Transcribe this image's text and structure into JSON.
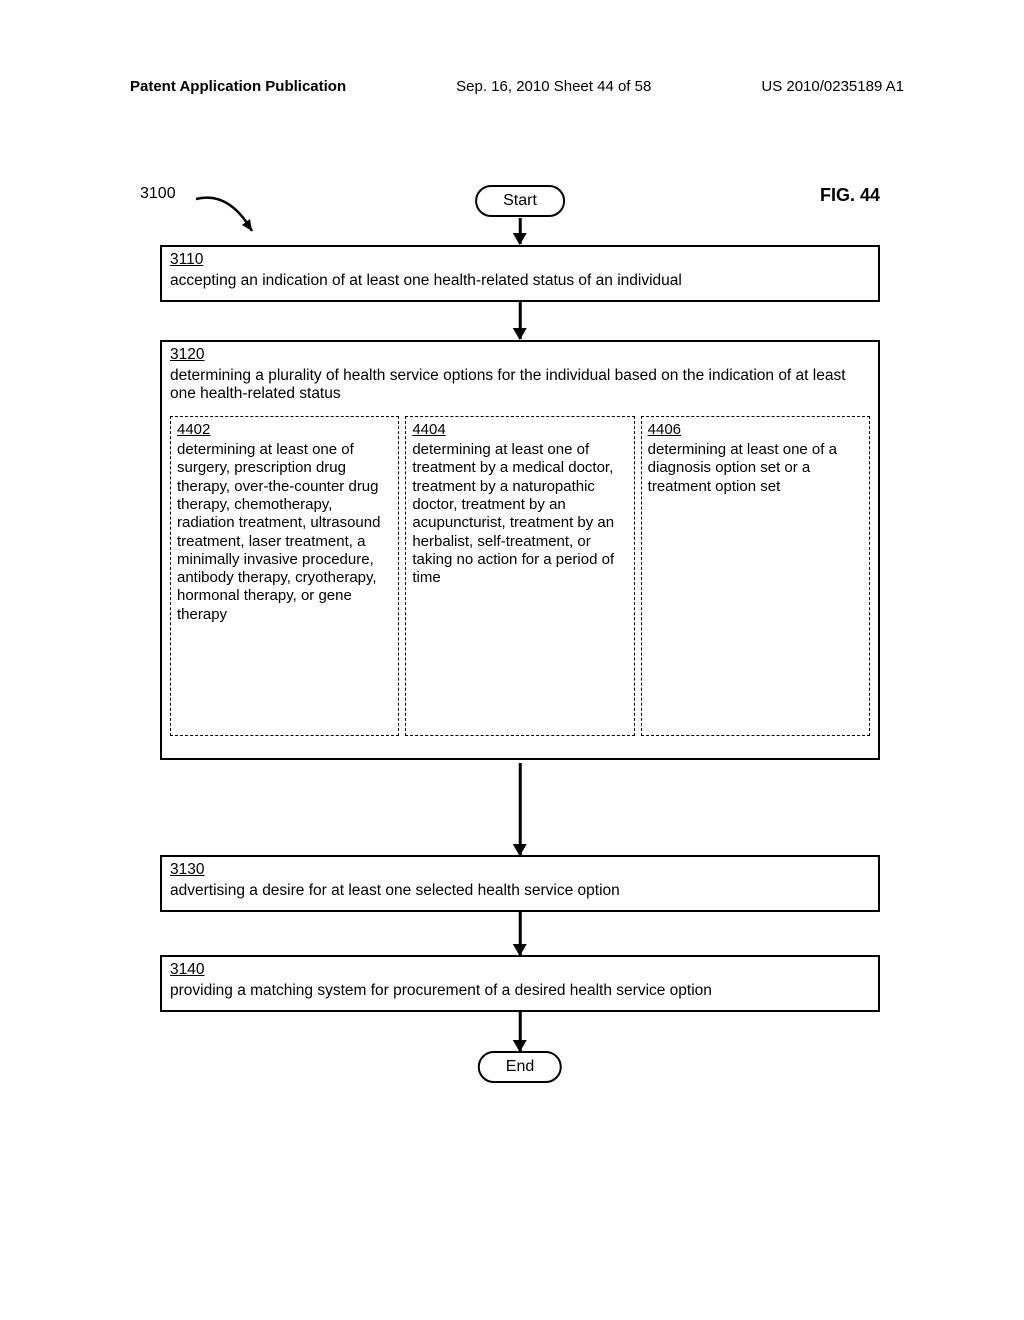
{
  "header": {
    "left": "Patent Application Publication",
    "center": "Sep. 16, 2010  Sheet 44 of 58",
    "right": "US 2010/0235189 A1"
  },
  "diagram": {
    "ref_num": "3100",
    "fig_label": "FIG. 44",
    "start": "Start",
    "end": "End",
    "step3110": {
      "num": "3110",
      "text": "accepting an indication of at least one health-related status of an individual"
    },
    "step3120": {
      "num": "3120",
      "text": "determining a plurality of health service options for the individual based on the indication of at least one health-related status",
      "sub4402": {
        "num": "4402",
        "text": "determining at least one of surgery, prescription drug therapy, over-the-counter drug therapy, chemotherapy, radiation treatment, ultrasound treatment, laser treatment, a minimally invasive procedure, antibody therapy, cryotherapy, hormonal therapy, or gene therapy"
      },
      "sub4404": {
        "num": "4404",
        "text": "determining at least one of treatment by a medical doctor, treatment by a naturopathic doctor, treatment by an acupuncturist, treatment by an herbalist, self-treatment, or taking no action for a period of time"
      },
      "sub4406": {
        "num": "4406",
        "text": "determining at least one of a diagnosis option set or a treatment option set"
      }
    },
    "step3130": {
      "num": "3130",
      "text": "advertising a desire for at least one selected health service option"
    },
    "step3140": {
      "num": "3140",
      "text": "providing a matching system for procurement of a desired health service option"
    }
  }
}
